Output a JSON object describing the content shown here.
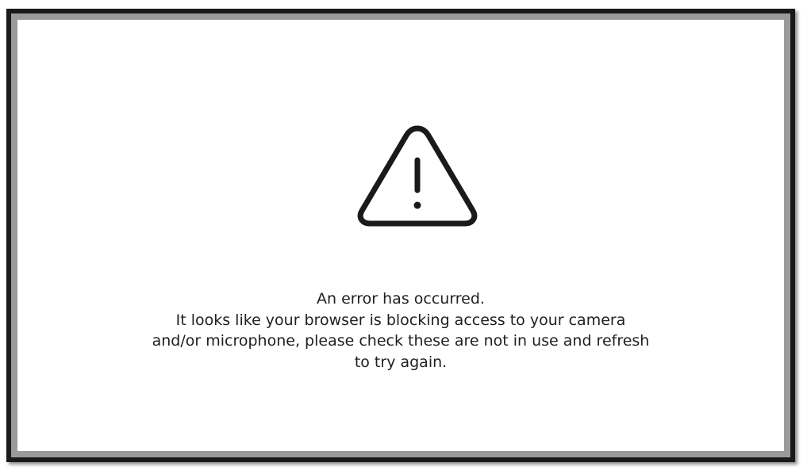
{
  "error_dialog": {
    "icon": "warning-triangle-icon",
    "lines": [
      "An error has occurred.",
      "It looks like your browser is blocking access to your camera",
      "and/or microphone, please check these are not in use and refresh",
      "to try again."
    ]
  },
  "colors": {
    "frame": "#1a1a1a",
    "frame_inner": "#9a9a9a",
    "panel": "#ffffff",
    "text": "#1f1f1f",
    "icon": "#1a1a1a"
  }
}
